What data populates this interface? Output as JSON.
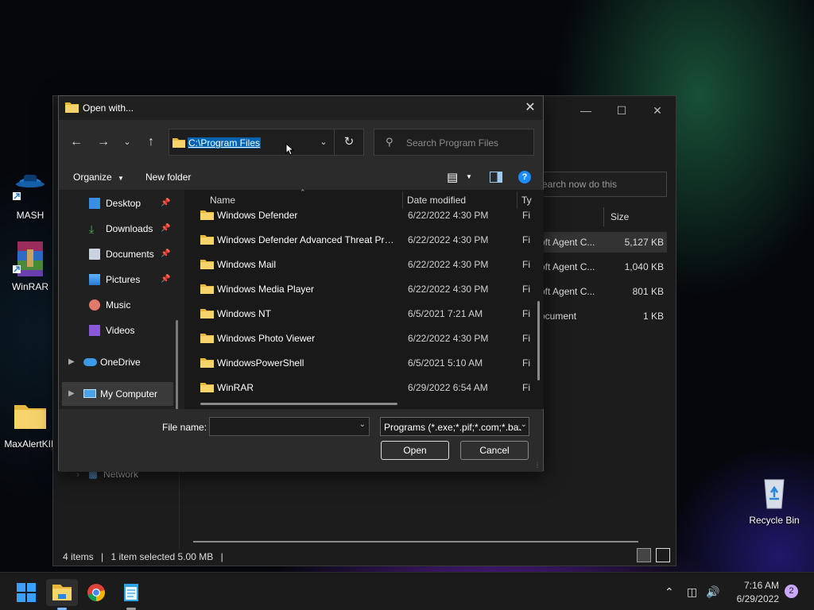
{
  "desktop": {
    "icons": [
      {
        "label": "MASH"
      },
      {
        "label": "WinRAR"
      },
      {
        "label": "MaxAlertKIL"
      },
      {
        "label": "Recycle Bin"
      }
    ]
  },
  "background_window": {
    "search_placeholder": "earch now do this",
    "size_header": "Size",
    "rows": [
      {
        "type": "oft Agent C...",
        "size": "5,127 KB",
        "selected": true
      },
      {
        "type": "oft Agent C...",
        "size": "1,040 KB"
      },
      {
        "type": "oft Agent C...",
        "size": "801 KB"
      },
      {
        "type": "ocument",
        "size": "1 KB"
      }
    ],
    "network_label": "Network",
    "status_items": "4 items",
    "status_selected": "1 item selected  5.00 MB"
  },
  "dialog": {
    "title": "Open with...",
    "address": "C:\\Program Files",
    "search_placeholder": "Search Program Files",
    "toolbar": {
      "organize": "Organize",
      "new_folder": "New folder"
    },
    "nav": [
      {
        "label": "Desktop",
        "icon": "desktop-icon",
        "pinned": true
      },
      {
        "label": "Downloads",
        "icon": "downloads-icon",
        "pinned": true
      },
      {
        "label": "Documents",
        "icon": "documents-icon",
        "pinned": true
      },
      {
        "label": "Pictures",
        "icon": "pictures-icon",
        "pinned": true
      },
      {
        "label": "Music",
        "icon": "music-icon",
        "pinned": false
      },
      {
        "label": "Videos",
        "icon": "videos-icon",
        "pinned": false
      },
      {
        "label": "OneDrive",
        "icon": "onedrive-icon",
        "pinned": false
      },
      {
        "label": "My Computer",
        "icon": "computer-icon",
        "pinned": false,
        "selected": true
      }
    ],
    "columns": {
      "name": "Name",
      "date": "Date modified",
      "type": "Ty"
    },
    "files": [
      {
        "name": "Windows Defender",
        "date": "6/22/2022 4:30 PM",
        "type": "Fi"
      },
      {
        "name": "Windows Defender Advanced Threat Prot...",
        "date": "6/22/2022 4:30 PM",
        "type": "Fi"
      },
      {
        "name": "Windows Mail",
        "date": "6/22/2022 4:30 PM",
        "type": "Fi"
      },
      {
        "name": "Windows Media Player",
        "date": "6/22/2022 4:30 PM",
        "type": "Fi"
      },
      {
        "name": "Windows NT",
        "date": "6/5/2021 7:21 AM",
        "type": "Fi"
      },
      {
        "name": "Windows Photo Viewer",
        "date": "6/22/2022 4:30 PM",
        "type": "Fi"
      },
      {
        "name": "WindowsPowerShell",
        "date": "6/5/2021 5:10 AM",
        "type": "Fi"
      },
      {
        "name": "WinRAR",
        "date": "6/29/2022 6:54 AM",
        "type": "Fi"
      }
    ],
    "file_name_label": "File name:",
    "file_name_value": "",
    "file_type_value": "Programs (*.exe;*.pif;*.com;*.bat",
    "open_button": "Open",
    "cancel_button": "Cancel"
  },
  "taskbar": {
    "time": "7:16 AM",
    "date": "6/29/2022",
    "notification_count": "2"
  },
  "colors": {
    "accent": "#0063b1",
    "folder": "#f2c14e",
    "help": "#1a8cff"
  }
}
